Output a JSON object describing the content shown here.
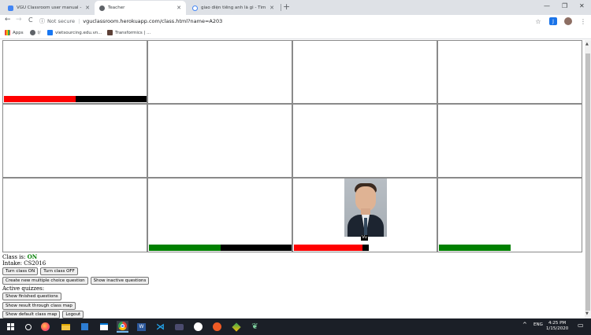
{
  "browser": {
    "tabs": [
      {
        "title": "VGU Classroom user manual - Go",
        "favicon_color": "#4285f4",
        "active": false
      },
      {
        "title": "Teacher",
        "favicon_color": "#5f6368",
        "active": true
      },
      {
        "title": "giao diện tiếng anh là gì - Tìm v",
        "favicon_color": "#4285f4",
        "active": false
      }
    ],
    "new_tab_symbol": "+",
    "window_controls": {
      "minimize": "—",
      "restore": "❐",
      "close": "✕"
    },
    "nav": {
      "back": "←",
      "forward": "→",
      "reload": "C"
    },
    "address": {
      "security": "Not secure",
      "url": "vguclassroom.herokuapp.com/class.html?name=A203"
    },
    "bookmarks": [
      {
        "label": "Apps",
        "icon_color": "#ea4335"
      },
      {
        "label": "l/",
        "icon_color": "#5f6368"
      },
      {
        "label": "vietsourcing.edu.vn...",
        "icon_color": "#1877f2"
      },
      {
        "label": "Transformics | ...",
        "icon_color": "#5d4037"
      }
    ]
  },
  "page": {
    "grid": {
      "cells": [
        {
          "bar": {
            "left_color": "#ff0000",
            "left_fraction": 0.5,
            "right_color": "#000000"
          }
        },
        {},
        {},
        {},
        {},
        {},
        {},
        {},
        {},
        {
          "bar": {
            "left_color": "#008000",
            "left_fraction": 0.5,
            "right_color": "#000000"
          }
        },
        {
          "bar": {
            "left_color": "#ff0000",
            "left_fraction": 0.47,
            "right_color": "#000000",
            "total_fraction": 0.52
          },
          "photo": true,
          "photo_label": "Vu"
        },
        {
          "bar": {
            "left_color": "#008000",
            "left_fraction": 0.5,
            "right_color": "#ffffff"
          }
        }
      ]
    },
    "class_status": {
      "label": "Class is:",
      "value": "ON"
    },
    "intake": {
      "label": "Intake:",
      "value": "CS2016"
    },
    "buttons": {
      "turn_on": "Turn class ON",
      "turn_off": "Turn class OFF",
      "create_mcq": "Create new multiple choice question",
      "show_inactive": "Show inactive questions",
      "show_finished": "Show finished questions",
      "show_result_map": "Show result through class map",
      "show_default_map": "Show default class map",
      "logout": "Logout"
    },
    "active_quizzes_label": "Active quizzes:"
  },
  "taskbar": {
    "language": "ENG",
    "time": "4:25 PM",
    "date": "1/15/2020"
  },
  "colors": {
    "status_on": "#008000",
    "taskbar_bg": "#1b1f27",
    "tabbar_bg": "#dee1e6"
  }
}
